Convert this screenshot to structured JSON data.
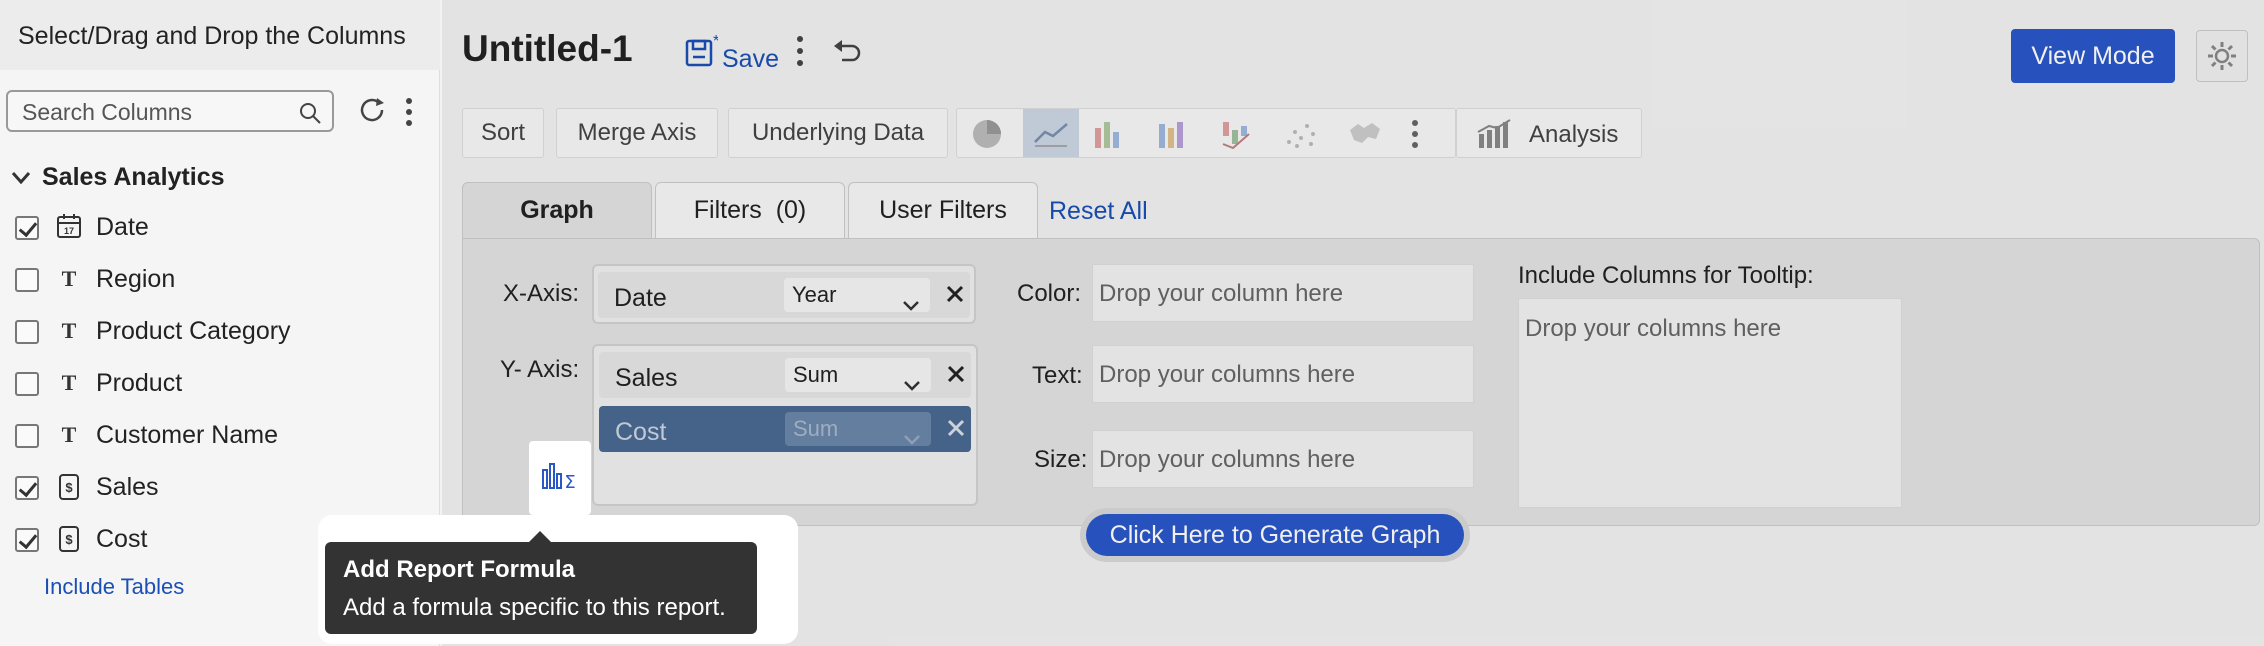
{
  "left_panel": {
    "title": "Select/Drag and Drop the Columns",
    "search_placeholder": "Search Columns",
    "folder": "Sales Analytics",
    "columns": [
      {
        "label": "Date",
        "type": "date",
        "checked": true
      },
      {
        "label": "Region",
        "type": "text",
        "checked": false
      },
      {
        "label": "Product Category",
        "type": "text",
        "checked": false
      },
      {
        "label": "Product",
        "type": "text",
        "checked": false
      },
      {
        "label": "Customer Name",
        "type": "text",
        "checked": false
      },
      {
        "label": "Sales",
        "type": "currency",
        "checked": true
      },
      {
        "label": "Cost",
        "type": "currency",
        "checked": true
      }
    ],
    "include_tables": "Include Tables"
  },
  "header": {
    "report_title": "Untitled-1",
    "save_label": "Save",
    "view_mode_label": "View Mode"
  },
  "toolbar": {
    "sort": "Sort",
    "merge_axis": "Merge Axis",
    "underlying_data": "Underlying Data",
    "analysis": "Analysis",
    "chart_types": [
      "pie-chart-icon",
      "line-chart-icon",
      "bar-chart-icon",
      "stacked-bar-icon",
      "waterfall-icon",
      "scatter-icon",
      "map-icon",
      "more-icon"
    ]
  },
  "tabs": {
    "graph": "Graph",
    "filters": "Filters  (0)",
    "user_filters": "User Filters",
    "reset_all": "Reset All"
  },
  "editor": {
    "x_axis_label": "X-Axis:",
    "y_axis_label": "Y- Axis:",
    "x_pill": {
      "name": "Date",
      "agg": "Year"
    },
    "y_pills": [
      {
        "name": "Sales",
        "agg": "Sum"
      },
      {
        "name": "Cost",
        "agg": "Sum"
      }
    ],
    "color_label": "Color:",
    "color_placeholder": "Drop your column here",
    "text_label": "Text:",
    "text_placeholder": "Drop your columns here",
    "size_label": "Size:",
    "size_placeholder": "Drop your columns here",
    "tooltip_label": "Include Columns for Tooltip:",
    "tooltip_placeholder": "Drop your columns here",
    "generate_label": "Click Here to Generate Graph"
  },
  "tooltip": {
    "title": "Add Report Formula",
    "text": "Add a formula specific to this report."
  },
  "colors": {
    "accent": "#2a57c8",
    "link": "#1a4fb5",
    "tooltip_bg": "#333333"
  }
}
